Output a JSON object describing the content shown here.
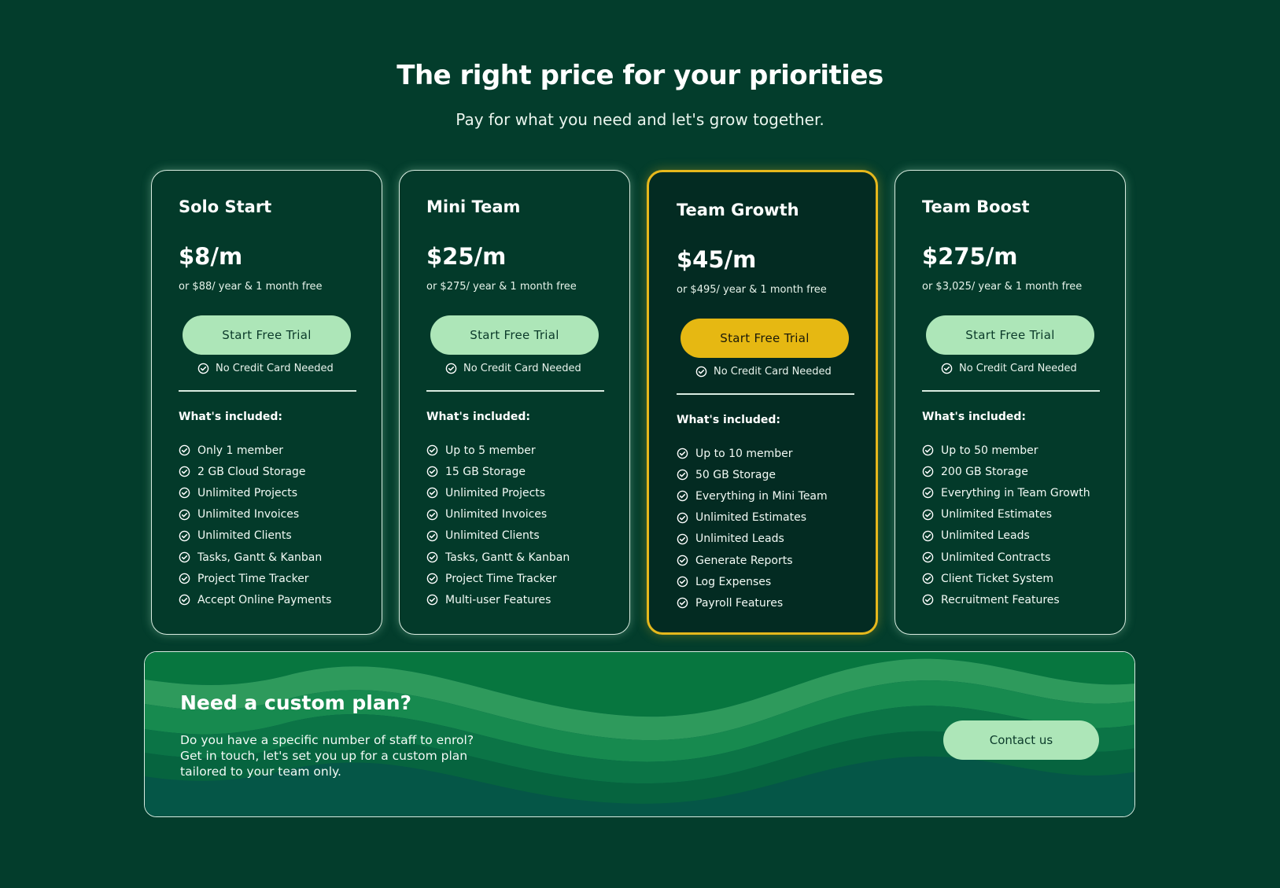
{
  "header": {
    "title": "The right price for your priorities",
    "subtitle": "Pay for what you need and let's grow together."
  },
  "colors": {
    "background": "#033d2c",
    "accent_green": "#ade6b8",
    "accent_gold": "#e6b812"
  },
  "plans": [
    {
      "name": "Solo Start",
      "price": "$8/m",
      "yearly": "or $88/ year & 1 month free",
      "cta": "Start Free Trial",
      "no_cc": "No Credit Card Needed",
      "included_label": "What's included:",
      "features": [
        "Only 1 member",
        "2 GB Cloud Storage",
        "Unlimited Projects",
        "Unlimited Invoices",
        "Unlimited Clients",
        "Tasks, Gantt & Kanban",
        "Project Time Tracker",
        "Accept Online Payments"
      ]
    },
    {
      "name": "Mini Team",
      "price": "$25/m",
      "yearly": "or $275/ year & 1 month free",
      "cta": "Start Free Trial",
      "no_cc": "No Credit Card Needed",
      "included_label": "What's included:",
      "features": [
        "Up to 5 member",
        "15 GB Storage",
        "Unlimited Projects",
        "Unlimited Invoices",
        "Unlimited Clients",
        "Tasks, Gantt & Kanban",
        "Project Time Tracker",
        "Multi-user Features"
      ]
    },
    {
      "name": "Team Growth",
      "price": "$45/m",
      "yearly": "or $495/ year & 1 month free",
      "cta": "Start Free Trial",
      "no_cc": "No Credit Card Needed",
      "included_label": "What's included:",
      "features": [
        "Up to 10 member",
        "50 GB Storage",
        "Everything in Mini Team",
        "Unlimited Estimates",
        "Unlimited Leads",
        "Generate Reports",
        "Log Expenses",
        "Payroll Features"
      ]
    },
    {
      "name": "Team Boost",
      "price": "$275/m",
      "yearly": "or $3,025/ year & 1 month free",
      "cta": "Start Free Trial",
      "no_cc": "No Credit Card Needed",
      "included_label": "What's included:",
      "features": [
        "Up to 50 member",
        "200 GB Storage",
        "Everything in Team Growth",
        "Unlimited Estimates",
        "Unlimited Leads",
        "Unlimited Contracts",
        "Client Ticket System",
        "Recruitment Features"
      ]
    }
  ],
  "custom_plan": {
    "title": "Need a custom plan?",
    "lines": [
      "Do you have a specific number of staff to enrol?",
      "Get in touch, let's set you up for a custom plan",
      "tailored to your team only."
    ],
    "button": "Contact us"
  }
}
